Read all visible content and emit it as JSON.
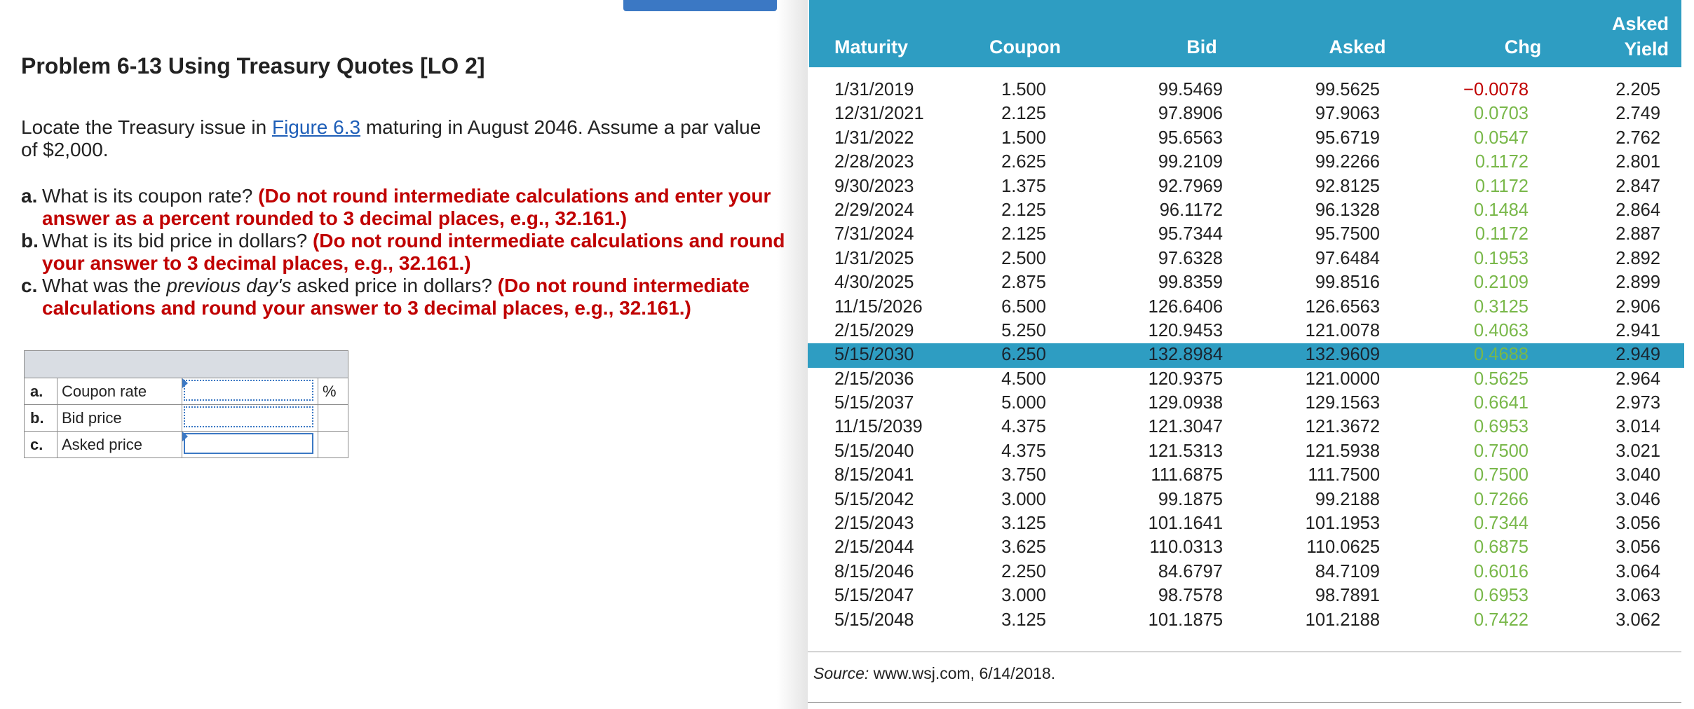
{
  "problem": {
    "title": "Problem 6-13 Using Treasury Quotes [LO 2]",
    "intro_before": "Locate the Treasury issue in ",
    "intro_link": "Figure 6.3",
    "intro_after": " maturing in August 2046. Assume a par value of $2,000.",
    "questions": [
      {
        "letter": "a.",
        "text_before": " What is its coupon rate? ",
        "hint": "(Do not round intermediate calculations and enter your answer as a percent rounded to 3 decimal places, e.g., 32.161.)"
      },
      {
        "letter": "b.",
        "text_before": " What is its bid price in dollars? ",
        "hint": "(Do not round intermediate calculations and round your answer to 3 decimal places, e.g., 32.161.)"
      },
      {
        "letter": "c.",
        "text_before": " What was the ",
        "emph": "previous day's",
        "text_after": " asked price in dollars? ",
        "hint": "(Do not round intermediate calculations and round your answer to 3 decimal places, e.g., 32.161.)"
      }
    ]
  },
  "answer_table": {
    "rows": [
      {
        "letter": "a.",
        "label": "Coupon rate",
        "value": "",
        "unit": "%"
      },
      {
        "letter": "b.",
        "label": "Bid price",
        "value": "",
        "unit": ""
      },
      {
        "letter": "c.",
        "label": "Asked price",
        "value": "",
        "unit": ""
      }
    ]
  },
  "treasury_table": {
    "headers": {
      "maturity": "Maturity",
      "coupon": "Coupon",
      "bid": "Bid",
      "asked": "Asked",
      "chg": "Chg",
      "yield_line1": "Asked",
      "yield_line2": "Yield"
    },
    "rows": [
      {
        "maturity": "1/31/2019",
        "coupon": "1.500",
        "bid": "99.5469",
        "asked": "99.5625",
        "chg": "−0.0078",
        "yield": "2.205"
      },
      {
        "maturity": "12/31/2021",
        "coupon": "2.125",
        "bid": "97.8906",
        "asked": "97.9063",
        "chg": "0.0703",
        "yield": "2.749"
      },
      {
        "maturity": "1/31/2022",
        "coupon": "1.500",
        "bid": "95.6563",
        "asked": "95.6719",
        "chg": "0.0547",
        "yield": "2.762"
      },
      {
        "maturity": "2/28/2023",
        "coupon": "2.625",
        "bid": "99.2109",
        "asked": "99.2266",
        "chg": "0.1172",
        "yield": "2.801"
      },
      {
        "maturity": "9/30/2023",
        "coupon": "1.375",
        "bid": "92.7969",
        "asked": "92.8125",
        "chg": "0.1172",
        "yield": "2.847"
      },
      {
        "maturity": "2/29/2024",
        "coupon": "2.125",
        "bid": "96.1172",
        "asked": "96.1328",
        "chg": "0.1484",
        "yield": "2.864"
      },
      {
        "maturity": "7/31/2024",
        "coupon": "2.125",
        "bid": "95.7344",
        "asked": "95.7500",
        "chg": "0.1172",
        "yield": "2.887"
      },
      {
        "maturity": "1/31/2025",
        "coupon": "2.500",
        "bid": "97.6328",
        "asked": "97.6484",
        "chg": "0.1953",
        "yield": "2.892"
      },
      {
        "maturity": "4/30/2025",
        "coupon": "2.875",
        "bid": "99.8359",
        "asked": "99.8516",
        "chg": "0.2109",
        "yield": "2.899"
      },
      {
        "maturity": "11/15/2026",
        "coupon": "6.500",
        "bid": "126.6406",
        "asked": "126.6563",
        "chg": "0.3125",
        "yield": "2.906"
      },
      {
        "maturity": "2/15/2029",
        "coupon": "5.250",
        "bid": "120.9453",
        "asked": "121.0078",
        "chg": "0.4063",
        "yield": "2.941"
      },
      {
        "maturity": "5/15/2030",
        "coupon": "6.250",
        "bid": "132.8984",
        "asked": "132.9609",
        "chg": "0.4688",
        "yield": "2.949",
        "highlighted": true
      },
      {
        "maturity": "2/15/2036",
        "coupon": "4.500",
        "bid": "120.9375",
        "asked": "121.0000",
        "chg": "0.5625",
        "yield": "2.964"
      },
      {
        "maturity": "5/15/2037",
        "coupon": "5.000",
        "bid": "129.0938",
        "asked": "129.1563",
        "chg": "0.6641",
        "yield": "2.973"
      },
      {
        "maturity": "11/15/2039",
        "coupon": "4.375",
        "bid": "121.3047",
        "asked": "121.3672",
        "chg": "0.6953",
        "yield": "3.014"
      },
      {
        "maturity": "5/15/2040",
        "coupon": "4.375",
        "bid": "121.5313",
        "asked": "121.5938",
        "chg": "0.7500",
        "yield": "3.021"
      },
      {
        "maturity": "8/15/2041",
        "coupon": "3.750",
        "bid": "111.6875",
        "asked": "111.7500",
        "chg": "0.7500",
        "yield": "3.040"
      },
      {
        "maturity": "5/15/2042",
        "coupon": "3.000",
        "bid": "99.1875",
        "asked": "99.2188",
        "chg": "0.7266",
        "yield": "3.046"
      },
      {
        "maturity": "2/15/2043",
        "coupon": "3.125",
        "bid": "101.1641",
        "asked": "101.1953",
        "chg": "0.7344",
        "yield": "3.056"
      },
      {
        "maturity": "2/15/2044",
        "coupon": "3.625",
        "bid": "110.0313",
        "asked": "110.0625",
        "chg": "0.6875",
        "yield": "3.056"
      },
      {
        "maturity": "8/15/2046",
        "coupon": "2.250",
        "bid": "84.6797",
        "asked": "84.7109",
        "chg": "0.6016",
        "yield": "3.064"
      },
      {
        "maturity": "5/15/2047",
        "coupon": "3.000",
        "bid": "98.7578",
        "asked": "98.7891",
        "chg": "0.6953",
        "yield": "3.063"
      },
      {
        "maturity": "5/15/2048",
        "coupon": "3.125",
        "bid": "101.1875",
        "asked": "101.2188",
        "chg": "0.7422",
        "yield": "3.062"
      }
    ],
    "source_label": "Source:",
    "source_text": " www.wsj.com, 6/14/2018."
  },
  "colors": {
    "header_bg": "#2e9dc2",
    "positive_chg": "#79b84a",
    "negative_chg": "#c00000",
    "hint_red": "#c00000",
    "link_blue": "#1f5fb8"
  }
}
